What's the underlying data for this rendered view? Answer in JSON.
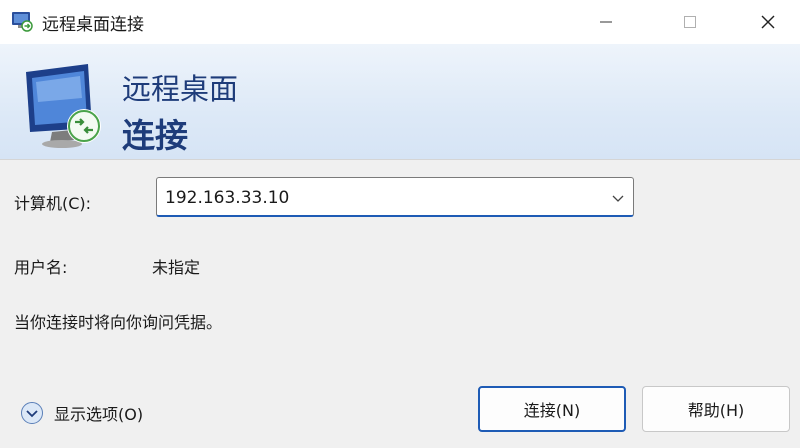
{
  "window": {
    "title": "远程桌面连接",
    "icon": "remote-desktop-icon",
    "controls": {
      "minimize_icon": "minimize-icon",
      "maximize_icon": "maximize-icon",
      "close_icon": "close-icon"
    }
  },
  "banner": {
    "line1": "远程桌面",
    "line2": "连接",
    "icon": "monitor-connection-icon",
    "gradient_colors": [
      "#eef4fb",
      "#d6e4f5"
    ],
    "text_color": "#1e3c7a"
  },
  "form": {
    "computer_label": "计算机(C):",
    "computer_value": "192.163.33.10",
    "username_label": "用户名:",
    "username_value": "未指定",
    "prompt": "当你连接时将向你询问凭据。"
  },
  "footer": {
    "options_label": "显示选项(O)",
    "options_icon": "chevron-down-circle-icon",
    "connect_label": "连接(N)",
    "help_label": "帮助(H)",
    "accent_color": "#1e5bb5"
  }
}
